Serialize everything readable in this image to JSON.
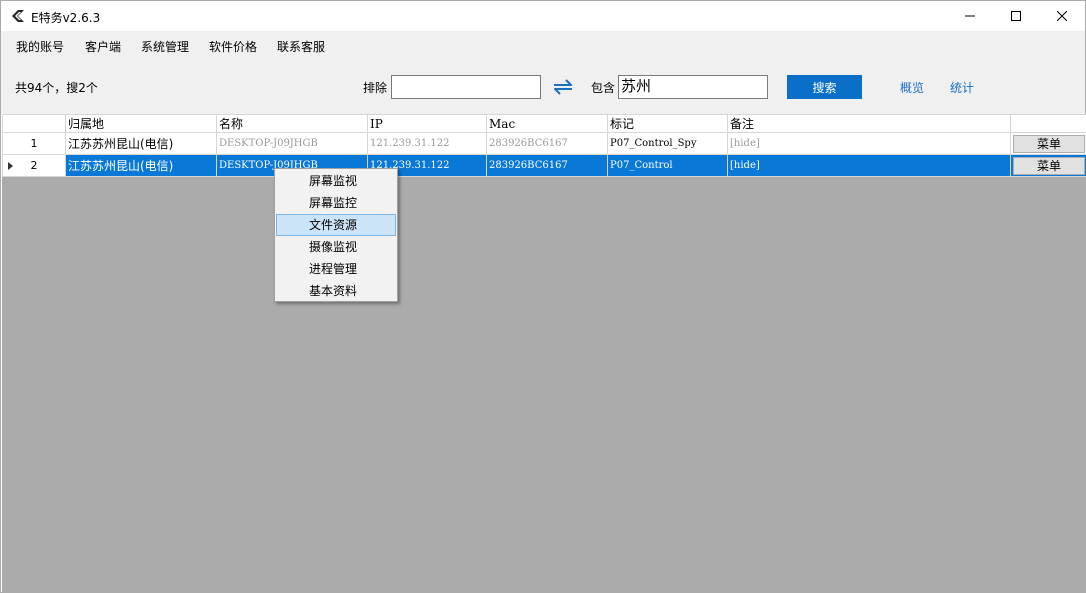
{
  "window": {
    "title": "E特务v2.6.3"
  },
  "menubar": {
    "items": [
      "我的账号",
      "客户端",
      "系统管理",
      "软件价格",
      "联系客服"
    ]
  },
  "toolbar": {
    "count_text": "共94个，搜2个",
    "exclude_label": "排除",
    "exclude_value": "",
    "include_label": "包含",
    "include_value": "苏州",
    "search_label": "搜索",
    "overview_label": "概览",
    "stats_label": "统计"
  },
  "grid": {
    "columns": [
      "归属地",
      "名称",
      "IP",
      "Mac",
      "标记",
      "备注"
    ],
    "rows": [
      {
        "num": "1",
        "place": "江苏苏州昆山(电信)",
        "name": "DESKTOP-J09JHGB",
        "ip": "121.239.31.122",
        "mac": "283926BC6167",
        "tag": "P07_Control_Spy",
        "note": "[hide]",
        "action": "菜单"
      },
      {
        "num": "2",
        "place": "江苏苏州昆山(电信)",
        "name": "DESKTOP-J09JHGB",
        "ip": "121.239.31.122",
        "mac": "283926BC6167",
        "tag": "P07_Control",
        "note": "[hide]",
        "action": "菜单"
      }
    ]
  },
  "context_menu": {
    "items": [
      "屏幕监视",
      "屏幕监控",
      "文件资源",
      "摄像监视",
      "进程管理",
      "基本资料"
    ],
    "active_index": 2
  },
  "colors": {
    "accent": "#0a78d7",
    "button": "#0a6fc8",
    "link": "#1a6fbf",
    "background": "#ababab"
  }
}
